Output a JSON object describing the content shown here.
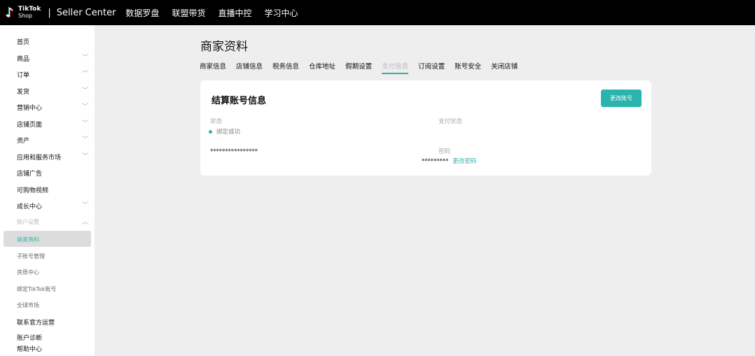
{
  "header": {
    "logo_top": "TikTok",
    "logo_bottom": "Shop",
    "separator": "|",
    "app": "Seller Center",
    "nav": [
      "数据罗盘",
      "联盟带货",
      "直播中控",
      "学习中心"
    ]
  },
  "sidebar": {
    "items": [
      {
        "label": "首页",
        "chevron": false
      },
      {
        "label": "商品",
        "chevron": true
      },
      {
        "label": "订单",
        "chevron": true
      },
      {
        "label": "发货",
        "chevron": true
      },
      {
        "label": "营销中心",
        "chevron": true
      },
      {
        "label": "店铺页面",
        "chevron": true
      },
      {
        "label": "资产",
        "chevron": true
      },
      {
        "label": "应用和服务市场",
        "chevron": true
      },
      {
        "label": "店铺广告",
        "chevron": false
      },
      {
        "label": "可购物视频",
        "chevron": false
      },
      {
        "label": "成长中心",
        "chevron": true
      }
    ],
    "group": "账户设置",
    "sub": [
      "商家资料",
      "子账号管理",
      "资质中心",
      "绑定TikTok账号",
      "全球市场"
    ],
    "bottom": [
      "联系官方运营",
      "账户诊断",
      "帮助中心"
    ]
  },
  "page": {
    "title": "商家资料",
    "tabs": [
      "商家信息",
      "店铺信息",
      "税务信息",
      "仓库地址",
      "假期设置",
      "支付信息",
      "订阅设置",
      "账号安全",
      "关闭店铺"
    ],
    "active_tab": 5
  },
  "card": {
    "title": "结算账号信息",
    "button": "更改账号",
    "status_label": "状态",
    "status_value": "绑定成功",
    "status_color": "#2bb4ad",
    "account": "****************",
    "pay_status_label": "支付状态",
    "password_label": "密码",
    "password_value": "*********",
    "change_password": "更改密码"
  }
}
